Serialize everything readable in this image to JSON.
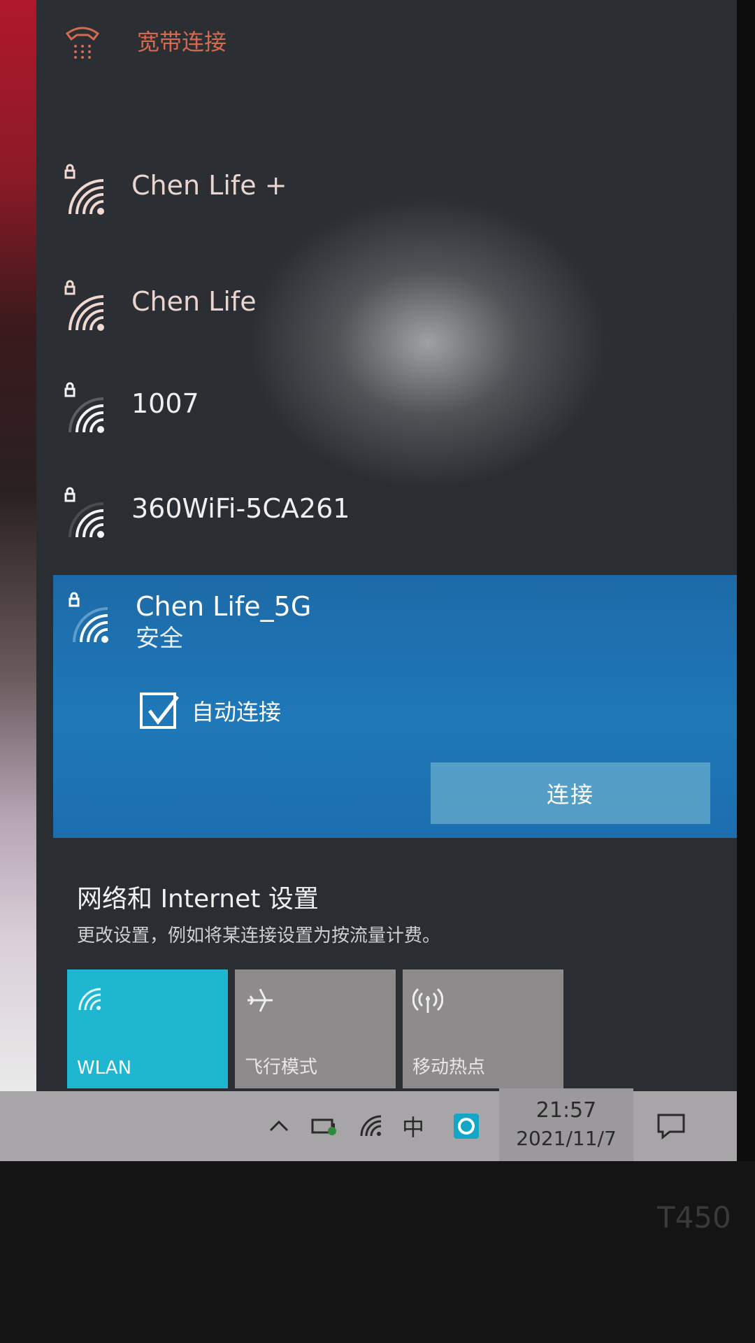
{
  "flyout": {
    "broadband": {
      "label": "宽带连接",
      "icon": "dialup-phone-icon"
    },
    "networks": [
      {
        "name": "Chen Life +",
        "status": "",
        "secured": true,
        "signal": 4
      },
      {
        "name": "Chen Life",
        "status": "",
        "secured": true,
        "signal": 4
      },
      {
        "name": "1007",
        "status": "",
        "secured": true,
        "signal": 3
      },
      {
        "name": "360WiFi-5CA261",
        "status": "",
        "secured": true,
        "signal": 3
      }
    ],
    "selected": {
      "name": "Chen Life_5G",
      "status": "安全",
      "auto_connect_label": "自动连接",
      "auto_connect_checked": true,
      "connect_button": "连接"
    },
    "settings": {
      "title": "网络和 Internet 设置",
      "subtitle": "更改设置，例如将某连接设置为按流量计费。"
    },
    "quick_tiles": [
      {
        "label": "WLAN",
        "icon": "wifi-icon",
        "active": true
      },
      {
        "label": "飞行模式",
        "icon": "airplane-icon",
        "active": false
      },
      {
        "label": "移动热点",
        "icon": "hotspot-icon",
        "active": false
      }
    ]
  },
  "taskbar": {
    "ime_label": "中",
    "time": "21:57",
    "date": "2021/11/7",
    "icons": [
      "chevron-up-icon",
      "battery-icon",
      "wifi-icon",
      "app-icon",
      "action-center-icon"
    ]
  },
  "device": {
    "brand": "T450"
  },
  "colors": {
    "accent_blue": "#1f78b8",
    "wlan_tile": "#1fb6cf",
    "broadband_text": "#d46a4e"
  }
}
